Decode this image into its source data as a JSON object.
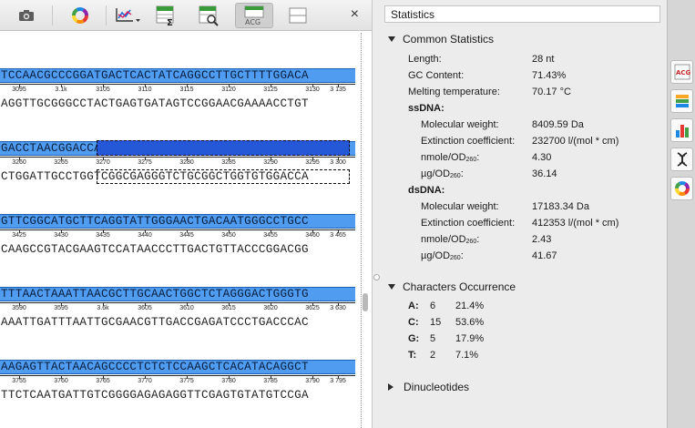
{
  "toolbar": {
    "icons": [
      "camera-icon",
      "color-wheel-icon",
      "graph-dropdown-icon",
      "sum-statistics-icon",
      "zoom-region-icon",
      "acg-statistics-icon",
      "split-view-icon",
      "close-icon"
    ],
    "close_label": "×"
  },
  "sequence": {
    "blocks": [
      {
        "top": "TCCAACGCCCGGATGACTCACTATCAGGCCTTGCTTTTGGACA",
        "bottom": "AGGTTGCGGGCCTACTGAGTGATAGTCCGGAACGAAAACCTGT",
        "ticks": [
          "3095",
          "3.1k",
          "3105",
          "3110",
          "3115",
          "3120",
          "3125",
          "3130",
          "3 135"
        ]
      },
      {
        "top": "GACCTAACGGACCAGCCGTCCCAGACGCCGACCACACCTGGT",
        "bottom": "CTGGATTGCCTGGTCGGCGAGGGTCTGCGGCTGGTGTGGACCA",
        "ticks": [
          "3260",
          "3265",
          "3270",
          "3275",
          "3280",
          "3285",
          "3290",
          "3295",
          "3 300"
        ]
      },
      {
        "top": "GTTCGGCATGCTTCAGGTATTGGGAACTGACAATGGGCCTGCC",
        "bottom": "CAAGCCGTACGAAGTCCATAACCCTTGACTGTTACCCGGACGG",
        "ticks": [
          "3425",
          "3430",
          "3435",
          "3440",
          "3445",
          "3450",
          "3455",
          "3460",
          "3 465"
        ]
      },
      {
        "top": "TTTAACTAAATTAACGCTTGCAACTGGCTCTAGGGACTGGGTG",
        "bottom": "AAATTGATTTAATTGCGAACGTTGACCGAGATCCCTGACCCAC",
        "ticks": [
          "3590",
          "3595",
          "3.6k",
          "3605",
          "3610",
          "3615",
          "3620",
          "3625",
          "3 630"
        ]
      },
      {
        "top": "AAGAGTTACTAACAGCCCCTCTCTCCAAGCTCACATACAGGCT",
        "bottom": "TTCTCAATGATTGTCGGGGAGAGAGGTTCGAGTGTATGTCCGA",
        "ticks": [
          "3755",
          "3760",
          "3765",
          "3770",
          "3775",
          "3780",
          "3785",
          "3790",
          "3 795"
        ]
      }
    ]
  },
  "stats": {
    "pane_title": "Statistics",
    "common": {
      "heading": "Common Statistics",
      "length_label": "Length:",
      "length_value": "28 nt",
      "gc_label": "GC Content:",
      "gc_value": "71.43%",
      "melt_label": "Melting temperature:",
      "melt_value": "70.17 °C"
    },
    "ssdna": {
      "heading": "ssDNA:",
      "mw_label": "Molecular weight:",
      "mw_value": "8409.59 Da",
      "ext_label": "Extinction coefficient:",
      "ext_value": "232700 l/(mol * cm)",
      "nmole_label": "nmole/OD",
      "nmole_sub": "260",
      "nmole_value": "4.30",
      "ug_label": "µg/OD",
      "ug_sub": "260",
      "ug_value": "36.14"
    },
    "dsdna": {
      "heading": "dsDNA:",
      "mw_label": "Molecular weight:",
      "mw_value": "17183.34 Da",
      "ext_label": "Extinction coefficient:",
      "ext_value": "412353 l/(mol * cm)",
      "nmole_label": "nmole/OD",
      "nmole_sub": "260",
      "nmole_value": "2.43",
      "ug_label": "µg/OD",
      "ug_sub": "260",
      "ug_value": "41.67"
    },
    "chars": {
      "heading": "Characters Occurrence",
      "rows": [
        {
          "base": "A:",
          "count": "6",
          "pct": "21.4%"
        },
        {
          "base": "C:",
          "count": "15",
          "pct": "53.6%"
        },
        {
          "base": "G:",
          "count": "5",
          "pct": "17.9%"
        },
        {
          "base": "T:",
          "count": "2",
          "pct": "7.1%"
        }
      ]
    },
    "dinucleotides": {
      "heading": "Dinucleotides"
    }
  },
  "tool_strip": {
    "icons": [
      "acg-statistics-icon",
      "annotations-icon",
      "bar-chart-icon",
      "dna-helix-icon",
      "color-wheel-icon"
    ]
  },
  "colors": {
    "sequence_highlight": "#4f9cf0",
    "selection": "#2458d6"
  }
}
